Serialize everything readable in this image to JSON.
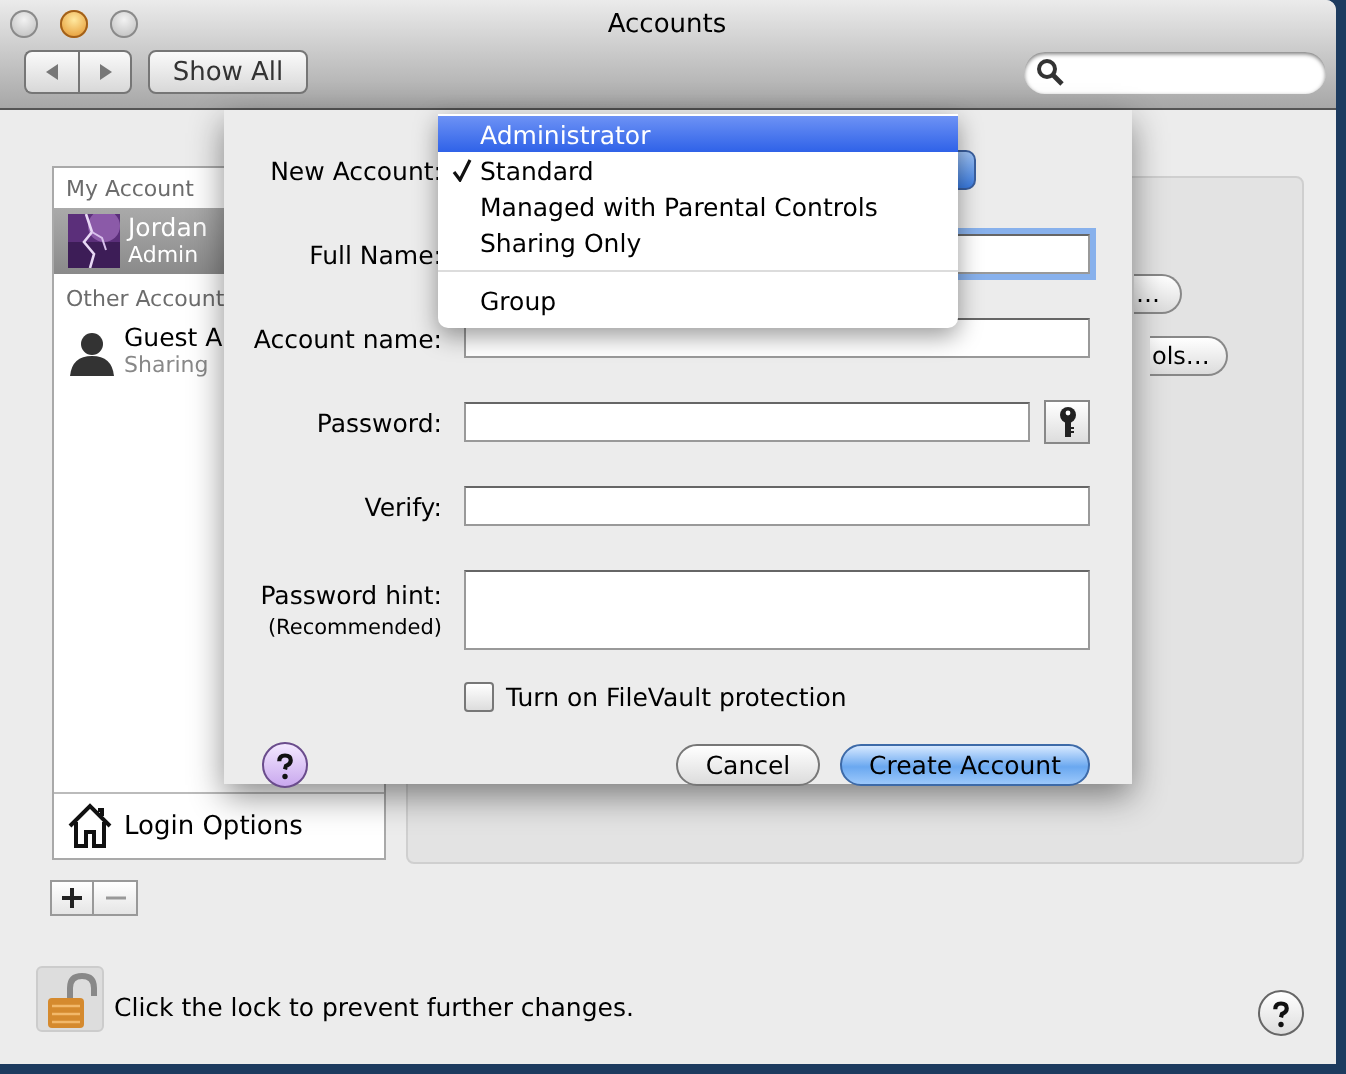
{
  "window": {
    "title": "Accounts"
  },
  "toolbar": {
    "show_all": "Show All"
  },
  "sidebar": {
    "sections": [
      {
        "header": "My Account",
        "items": [
          {
            "name": "Jordan",
            "role": "Admin",
            "selected": true
          }
        ]
      },
      {
        "header": "Other Account",
        "items": [
          {
            "name": "Guest A",
            "role": "Sharing",
            "kind": "silhouette",
            "selected": false
          }
        ]
      }
    ],
    "login_options": "Login Options"
  },
  "account_pane": {
    "change_password": "…",
    "parental_button": "ols…"
  },
  "lock": {
    "text": "Click the lock to prevent further changes.",
    "locked": false
  },
  "sheet": {
    "new_account_label": "New Account:",
    "fields": [
      {
        "label": "Full Name:",
        "kind": "text",
        "focused": true
      },
      {
        "label": "Account name:",
        "kind": "text",
        "focused": false
      },
      {
        "label": "Password:",
        "kind": "password",
        "focused": false
      },
      {
        "label": "Verify:",
        "kind": "text",
        "focused": false
      },
      {
        "label": "Password hint:",
        "note": "(Recommended)",
        "kind": "multiline",
        "focused": false
      }
    ],
    "filevault": {
      "label": "Turn on FileVault protection",
      "checked": false
    },
    "buttons": [
      {
        "label": "Cancel",
        "default": false
      },
      {
        "label": "Create Account",
        "default": true
      }
    ]
  },
  "menu": {
    "items": [
      {
        "kind": "item",
        "label": "Administrator",
        "highlighted": true,
        "checked": false
      },
      {
        "kind": "item",
        "label": "Standard",
        "highlighted": false,
        "checked": true
      },
      {
        "kind": "item",
        "label": "Managed with Parental Controls",
        "highlighted": false,
        "checked": false
      },
      {
        "kind": "item",
        "label": "Sharing Only",
        "highlighted": false,
        "checked": false
      },
      {
        "kind": "separator"
      },
      {
        "kind": "item",
        "label": "Group",
        "highlighted": false,
        "checked": false
      }
    ]
  }
}
